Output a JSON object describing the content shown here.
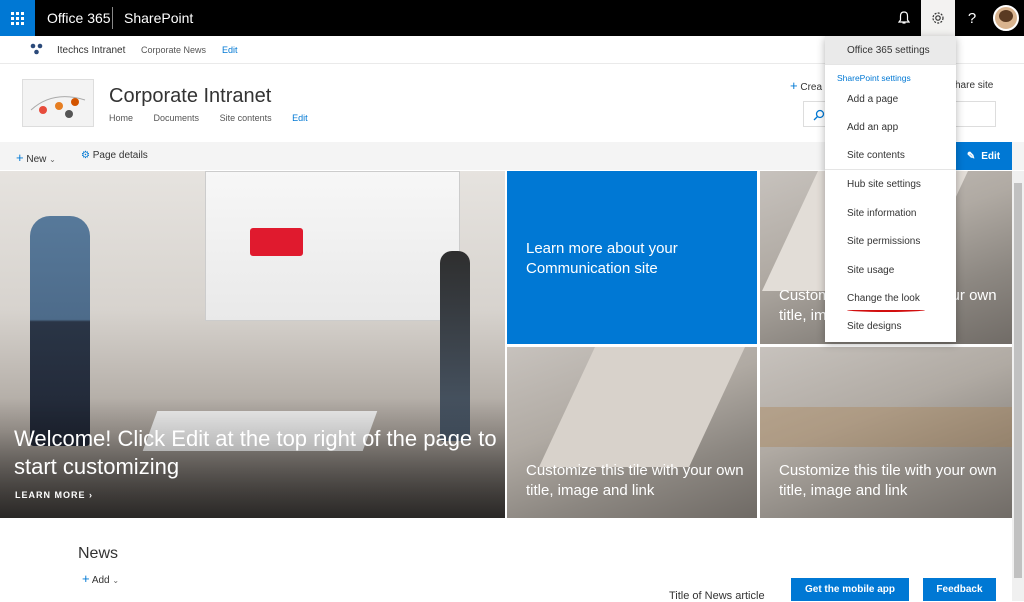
{
  "suitebar": {
    "app": "Office 365",
    "product": "SharePoint"
  },
  "hub": {
    "name": "Itechcs Intranet",
    "links": [
      "Corporate News",
      "Edit"
    ]
  },
  "site": {
    "title": "Corporate Intranet",
    "nav": [
      "Home",
      "Documents",
      "Site contents",
      "Edit"
    ],
    "create_label": "Crea",
    "share_label": "hare site"
  },
  "commandbar": {
    "new": "New",
    "page_details": "Page details",
    "edit": "Edit"
  },
  "hero": {
    "main_text": "Welcome! Click Edit at the top right of the page to start customizing",
    "learn_more": "LEARN MORE",
    "blue_tile": "Learn more about your Communication site",
    "tile_right": "Customize this tile with your own title, image and link",
    "tile_bottom_center": "Customize this tile with your own title, image and link",
    "tile_bottom_right": "Customize this tile with your own title, image and link"
  },
  "news": {
    "title": "News",
    "add": "Add",
    "article_title": "Title of News article"
  },
  "buttons": {
    "mobile": "Get the mobile app",
    "feedback": "Feedback"
  },
  "settings_menu": {
    "header": "Office 365 settings",
    "section": "SharePoint settings",
    "items": [
      "Add a page",
      "Add an app",
      "Site contents",
      "Hub site settings",
      "Site information",
      "Site permissions",
      "Site usage",
      "Change the look",
      "Site designs"
    ]
  },
  "colors": {
    "accent": "#0078d4",
    "suitebar": "#000000",
    "annotation": "#d20f0f"
  },
  "icons": {
    "waffle": "app-launcher-icon",
    "bell": "notification-icon",
    "gear": "settings-gear-icon",
    "help": "help-icon"
  }
}
